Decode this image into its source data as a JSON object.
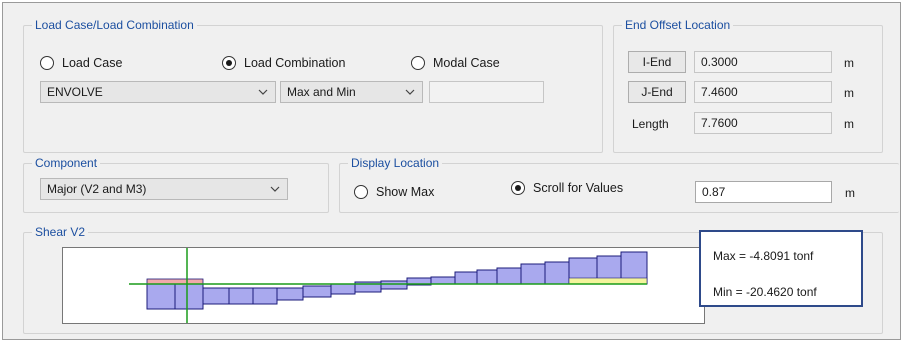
{
  "load_case_group": {
    "title": "Load Case/Load Combination",
    "options": [
      "Load Case",
      "Load Combination",
      "Modal Case"
    ],
    "selected_index": 1,
    "combination_value": "ENVOLVE",
    "envelope_value": "Max and Min",
    "extra_value": ""
  },
  "end_offset": {
    "title": "End Offset Location",
    "i_end_label": "I-End",
    "i_end_value": "0.3000",
    "j_end_label": "J-End",
    "j_end_value": "7.4600",
    "length_label": "Length",
    "length_value": "7.7600",
    "unit": "m"
  },
  "component": {
    "title": "Component",
    "value": "Major (V2 and M3)"
  },
  "display_location": {
    "title": "Display Location",
    "options": [
      "Show Max",
      "Scroll for Values"
    ],
    "selected_index": 1,
    "value": "0.87",
    "unit": "m"
  },
  "shear": {
    "title": "Shear V2",
    "max_text": "Max = -4.8091 tonf",
    "min_text": "Min = -20.4620 tonf",
    "colors": {
      "bars": "#a9a9ee",
      "bar_outline": "#1b1b7a",
      "axis": "#1a9c1a",
      "positive_fill": "#f2a9a9",
      "negative_fill": "#f4f49c",
      "cursor": "#1a9c1a"
    }
  }
}
